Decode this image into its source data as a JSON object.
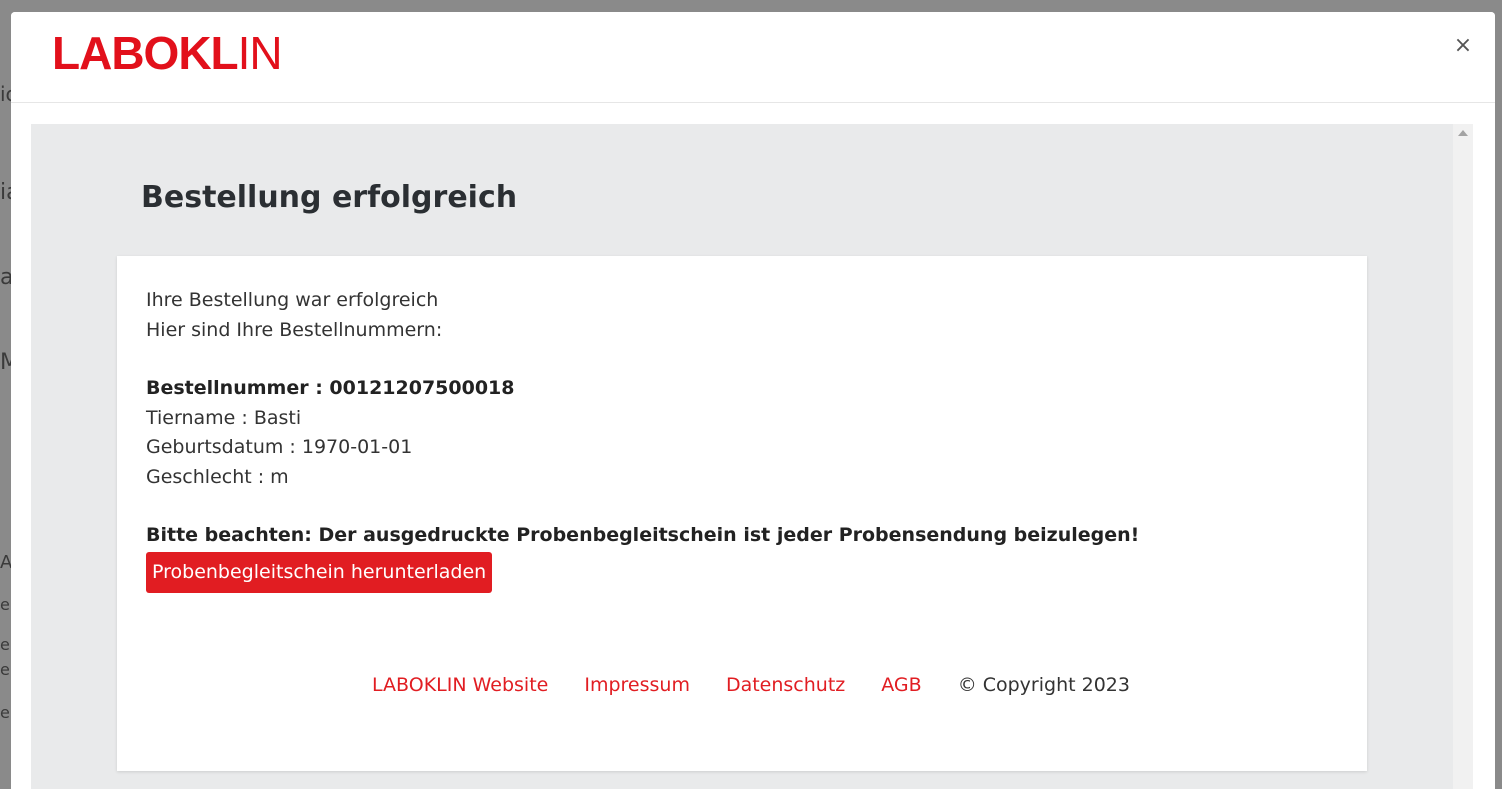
{
  "background": {
    "fragments": [
      "ic",
      "ia",
      "a",
      "M",
      "A",
      "e",
      "e",
      "e",
      "e"
    ]
  },
  "header": {
    "logo_bold": "LABOKL",
    "logo_thin": "IN",
    "close_label": "×"
  },
  "main": {
    "title": "Bestellung erfolgreich",
    "intro_line_1": "Ihre Bestellung war erfolgreich",
    "intro_line_2": "Hier sind Ihre Bestellnummern:",
    "order_number": "Bestellnummer : 00121207500018",
    "pet_name": "Tiername : Basti",
    "birth_date": "Geburtsdatum : 1970-01-01",
    "sex": "Geschlecht : m",
    "notice": "Bitte beachten: Der ausgedruckte Probenbegleitschein ist jeder Probensendung beizulegen!",
    "download_button": "Probenbegleitschein herunterladen"
  },
  "footer": {
    "links": [
      "LABOKLIN Website",
      "Impressum",
      "Datenschutz",
      "AGB"
    ],
    "copyright": "© Copyright 2023"
  },
  "colors": {
    "brand_red": "#e11d22",
    "body_bg": "#e9eaeb"
  }
}
